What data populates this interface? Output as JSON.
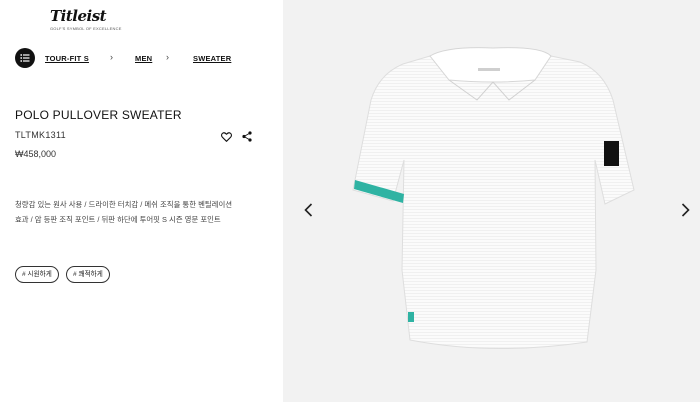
{
  "brand": {
    "logo_text": "Titleist",
    "tagline": "GOLF'S SYMBOL OF EXCELLENCE"
  },
  "breadcrumb": {
    "items": [
      "TOUR-FIT S",
      "MEN",
      "SWEATER"
    ],
    "separator": "›"
  },
  "product": {
    "title": "POLO PULLOVER SWEATER",
    "sku": "TLTMK1311",
    "price": "₩458,000",
    "description_lines": [
      "청량감 있는 원사 사용 / 드라이한 터치감 / 메쉬 조직을 통한 벤틸레이션",
      "효과 / 암 등판 조직 포인트 / 뒤판 하단에 투어핏 S 시즌 영문 포인트"
    ],
    "tags": [
      "# 시원하게",
      "# 쾌적하게"
    ]
  },
  "icons": {
    "menu": "menu-list-icon",
    "wishlist": "heart-icon",
    "share": "share-icon",
    "prev": "chevron-left-icon",
    "next": "chevron-right-icon"
  },
  "colors": {
    "accent": "#2fb3a3",
    "text": "#111111",
    "image_bg": "#f2f2f2"
  }
}
